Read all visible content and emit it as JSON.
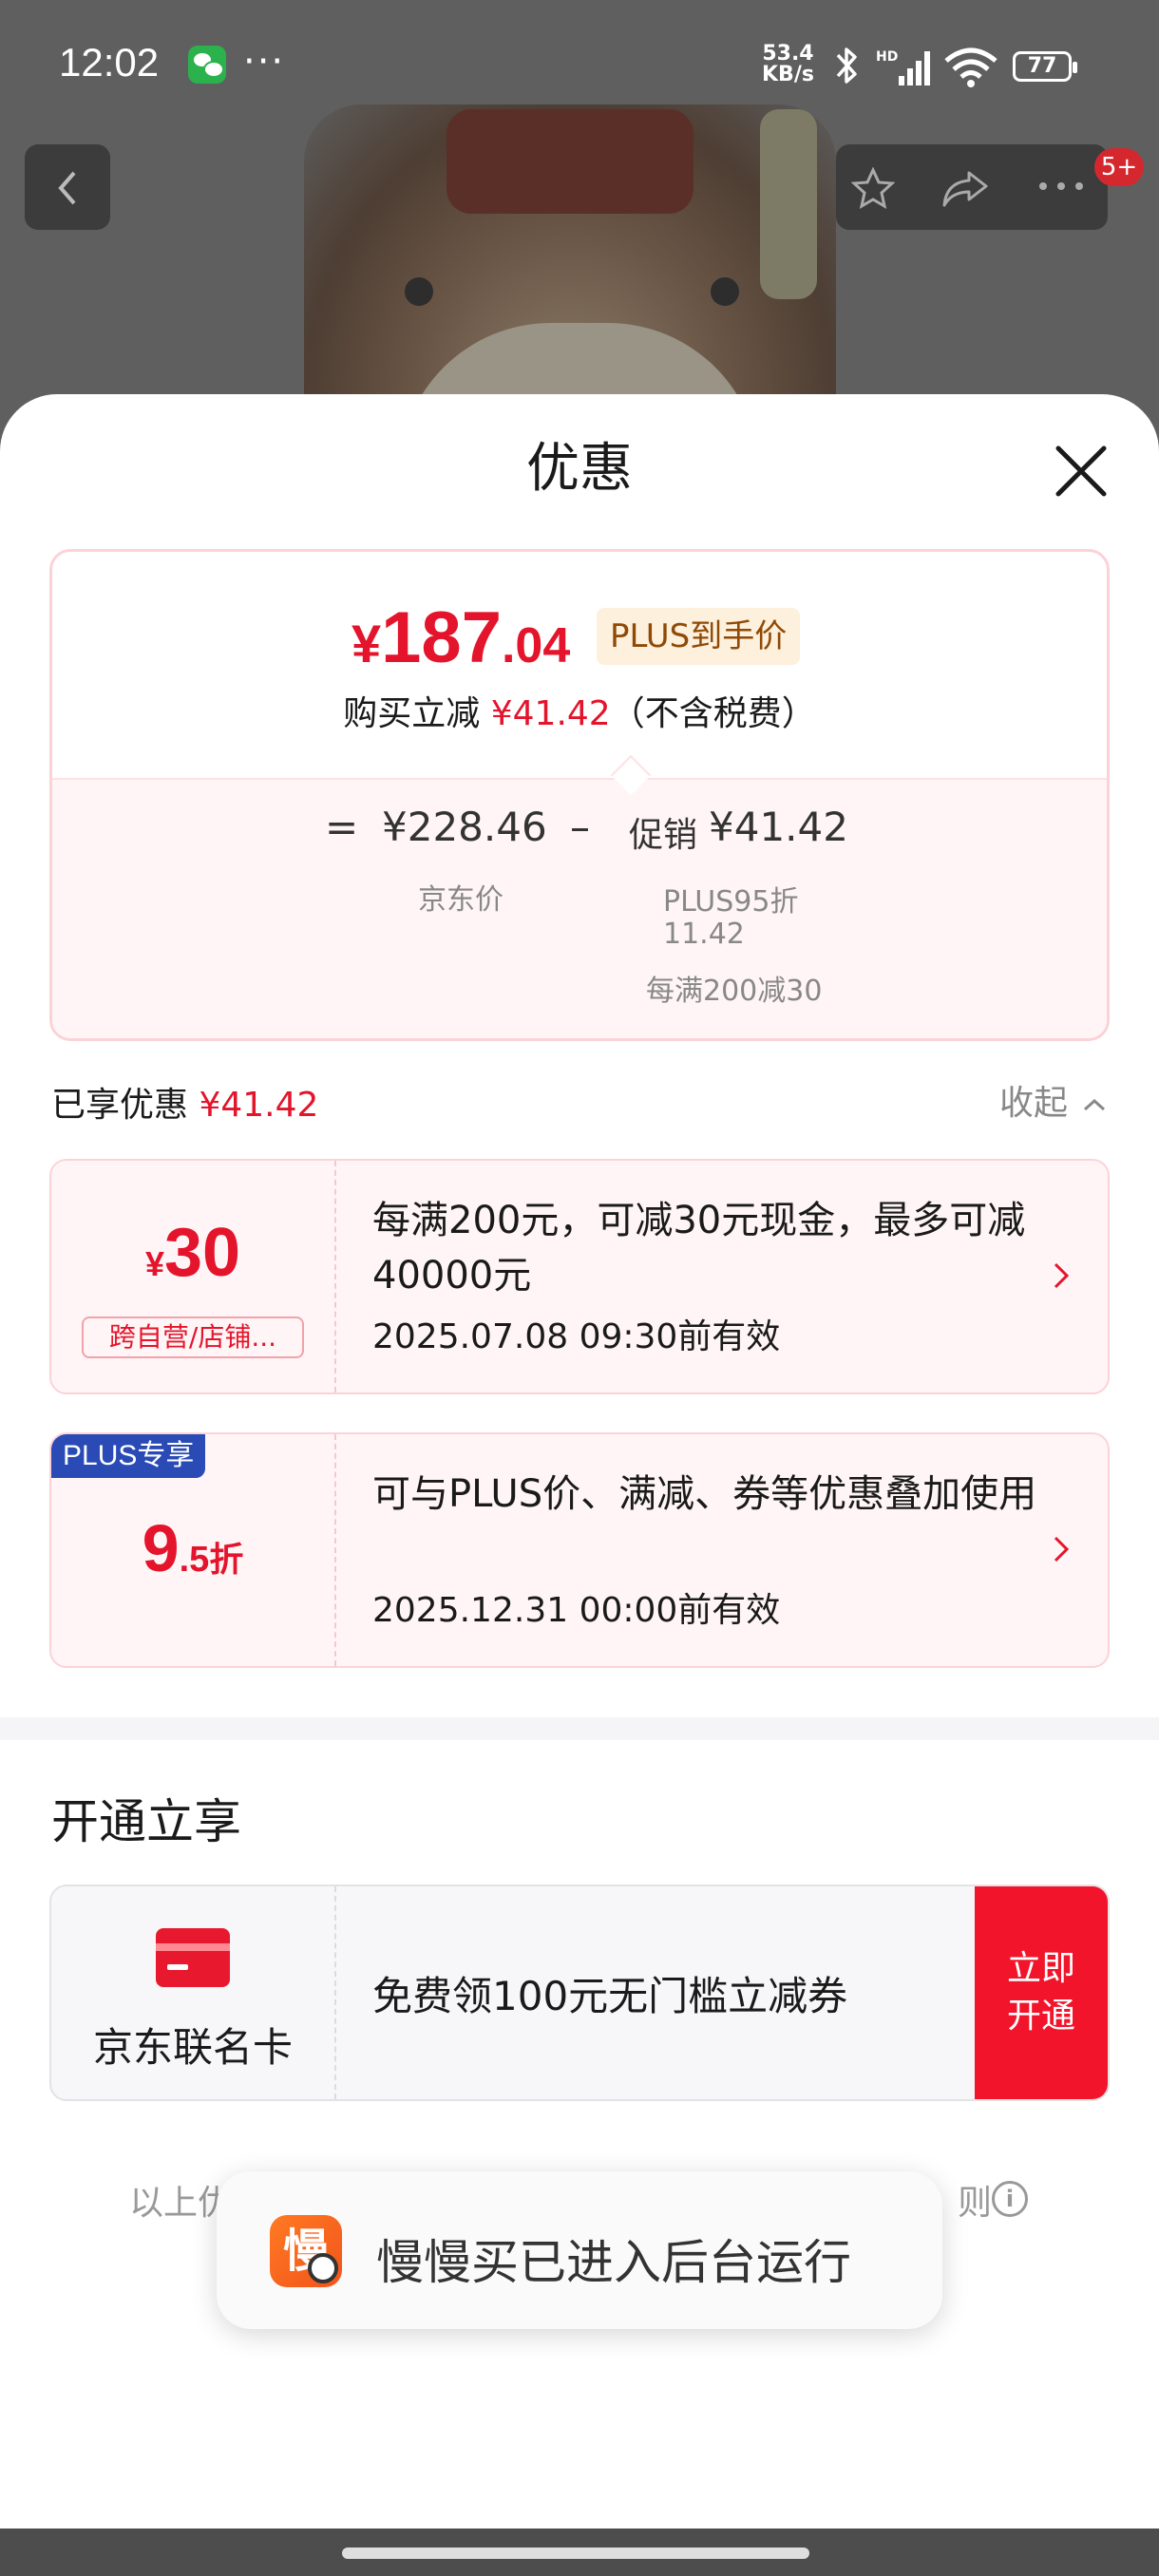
{
  "status_bar": {
    "time": "12:02",
    "net_speed_value": "53.4",
    "net_speed_unit": "KB/s",
    "battery": "77"
  },
  "nav": {
    "cart_badge": "5+"
  },
  "sheet": {
    "title": "优惠"
  },
  "price": {
    "currency": "¥",
    "integer": "187",
    "decimal": ".04",
    "plus_tag": "PLUS到手价",
    "reduce_label": "购买立减",
    "reduce_amount": "¥41.42",
    "tax_note": "（不含税费）",
    "equals": "=",
    "jd_price": "¥228.46",
    "jd_price_label": "京东价",
    "minus": "–",
    "promo_label": "促销",
    "promo_amount": "¥41.42",
    "promo_detail_1": "PLUS95折",
    "promo_detail_1_value": "11.42",
    "promo_detail_2": "每满200减30"
  },
  "enjoyed": {
    "label": "已享优惠",
    "amount": "¥41.42",
    "collapse_label": "收起"
  },
  "coupons": [
    {
      "currency": "¥",
      "amount": "30",
      "scope": "跨自营/店铺...",
      "desc": "每满200元，可减30元现金，最多可减40000元",
      "valid": "2025.07.08 09:30前有效"
    },
    {
      "badge": "PLUS专享",
      "amount": "9",
      "decimal": ".5",
      "unit": "折",
      "desc": "可与PLUS价、满减、券等优惠叠加使用",
      "valid": "2025.12.31 00:00前有效"
    }
  ],
  "open_section": {
    "title": "开通立享",
    "card_name": "京东联名卡",
    "desc": "免费领100元无门槛立减券",
    "button_line1": "立即",
    "button_line2": "开通"
  },
  "footer": {
    "note_left": "以上优",
    "note_right": "则"
  },
  "toast": {
    "icon_char": "慢",
    "text": "慢慢买已进入后台运行"
  },
  "colors": {
    "accent_red": "#e3142b",
    "plus_blue": "#2a4bb5",
    "plus_gold_bg": "#fdf0dd"
  }
}
